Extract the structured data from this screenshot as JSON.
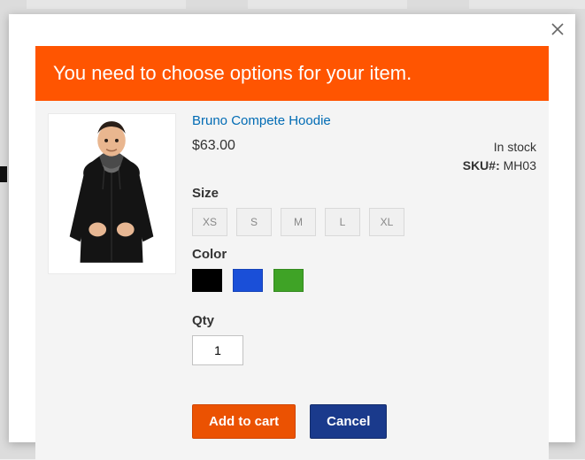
{
  "banner": {
    "message": "You need to choose options for your item."
  },
  "product": {
    "name": "Bruno Compete Hoodie",
    "price": "$63.00",
    "stock_status": "In stock",
    "sku_label": "SKU#:",
    "sku_value": "MH03"
  },
  "size": {
    "label": "Size",
    "options": [
      "XS",
      "S",
      "M",
      "L",
      "XL"
    ]
  },
  "color": {
    "label": "Color",
    "options": [
      "#000000",
      "#1a4fd8",
      "#3fa326"
    ]
  },
  "qty": {
    "label": "Qty",
    "value": "1"
  },
  "buttons": {
    "add": "Add to cart",
    "cancel": "Cancel"
  }
}
